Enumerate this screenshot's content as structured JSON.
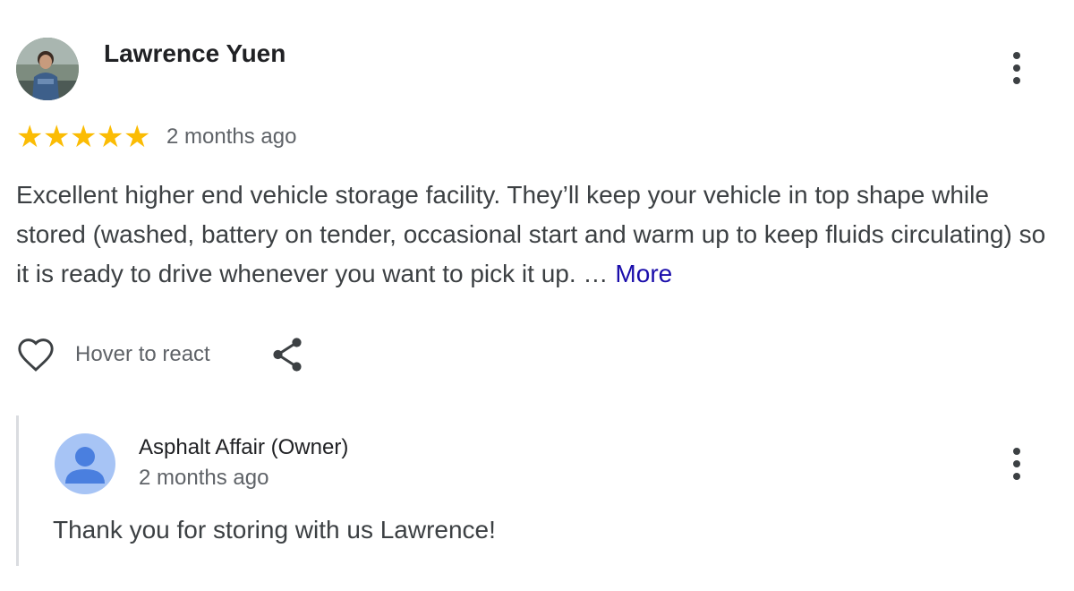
{
  "review": {
    "reviewer_name": "Lawrence Yuen",
    "rating": 5,
    "stars": [
      "★",
      "★",
      "★",
      "★",
      "★"
    ],
    "time": "2 months ago",
    "text": "Excellent higher end vehicle storage facility. They’ll keep your vehicle in top shape while stored (washed, battery on tender, occasional start and warm up to keep fluids circulating) so it is ready to drive whenever you want to pick it up. …",
    "more_label": "More",
    "react_label": "Hover to react"
  },
  "reply": {
    "owner_name": "Asphalt Affair (Owner)",
    "time": "2 months ago",
    "text": "Thank you for storing with us Lawrence!"
  },
  "colors": {
    "star": "#fbbc04",
    "link": "#1a0dab",
    "owner_avatar": "#a7c4f5",
    "owner_avatar_icon": "#4a7fdf"
  },
  "icons": [
    "more-vert-icon",
    "heart-icon",
    "share-icon",
    "person-icon"
  ]
}
